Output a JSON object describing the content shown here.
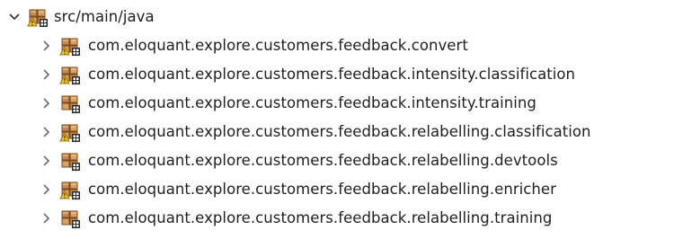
{
  "tree": {
    "root": {
      "label": "src/main/java",
      "expanded": true,
      "icon": "source-folder-packages-icon"
    },
    "packages": [
      {
        "label": "com.eloquant.explore.customers.feedback.convert",
        "icon": "package-warning-icon"
      },
      {
        "label": "com.eloquant.explore.customers.feedback.intensity.classification",
        "icon": "package-warning-icon"
      },
      {
        "label": "com.eloquant.explore.customers.feedback.intensity.training",
        "icon": "package-icon"
      },
      {
        "label": "com.eloquant.explore.customers.feedback.relabelling.classification",
        "icon": "package-warning-icon"
      },
      {
        "label": "com.eloquant.explore.customers.feedback.relabelling.devtools",
        "icon": "package-icon"
      },
      {
        "label": "com.eloquant.explore.customers.feedback.relabelling.enricher",
        "icon": "package-warning-icon"
      },
      {
        "label": "com.eloquant.explore.customers.feedback.relabelling.training",
        "icon": "package-icon"
      }
    ]
  }
}
